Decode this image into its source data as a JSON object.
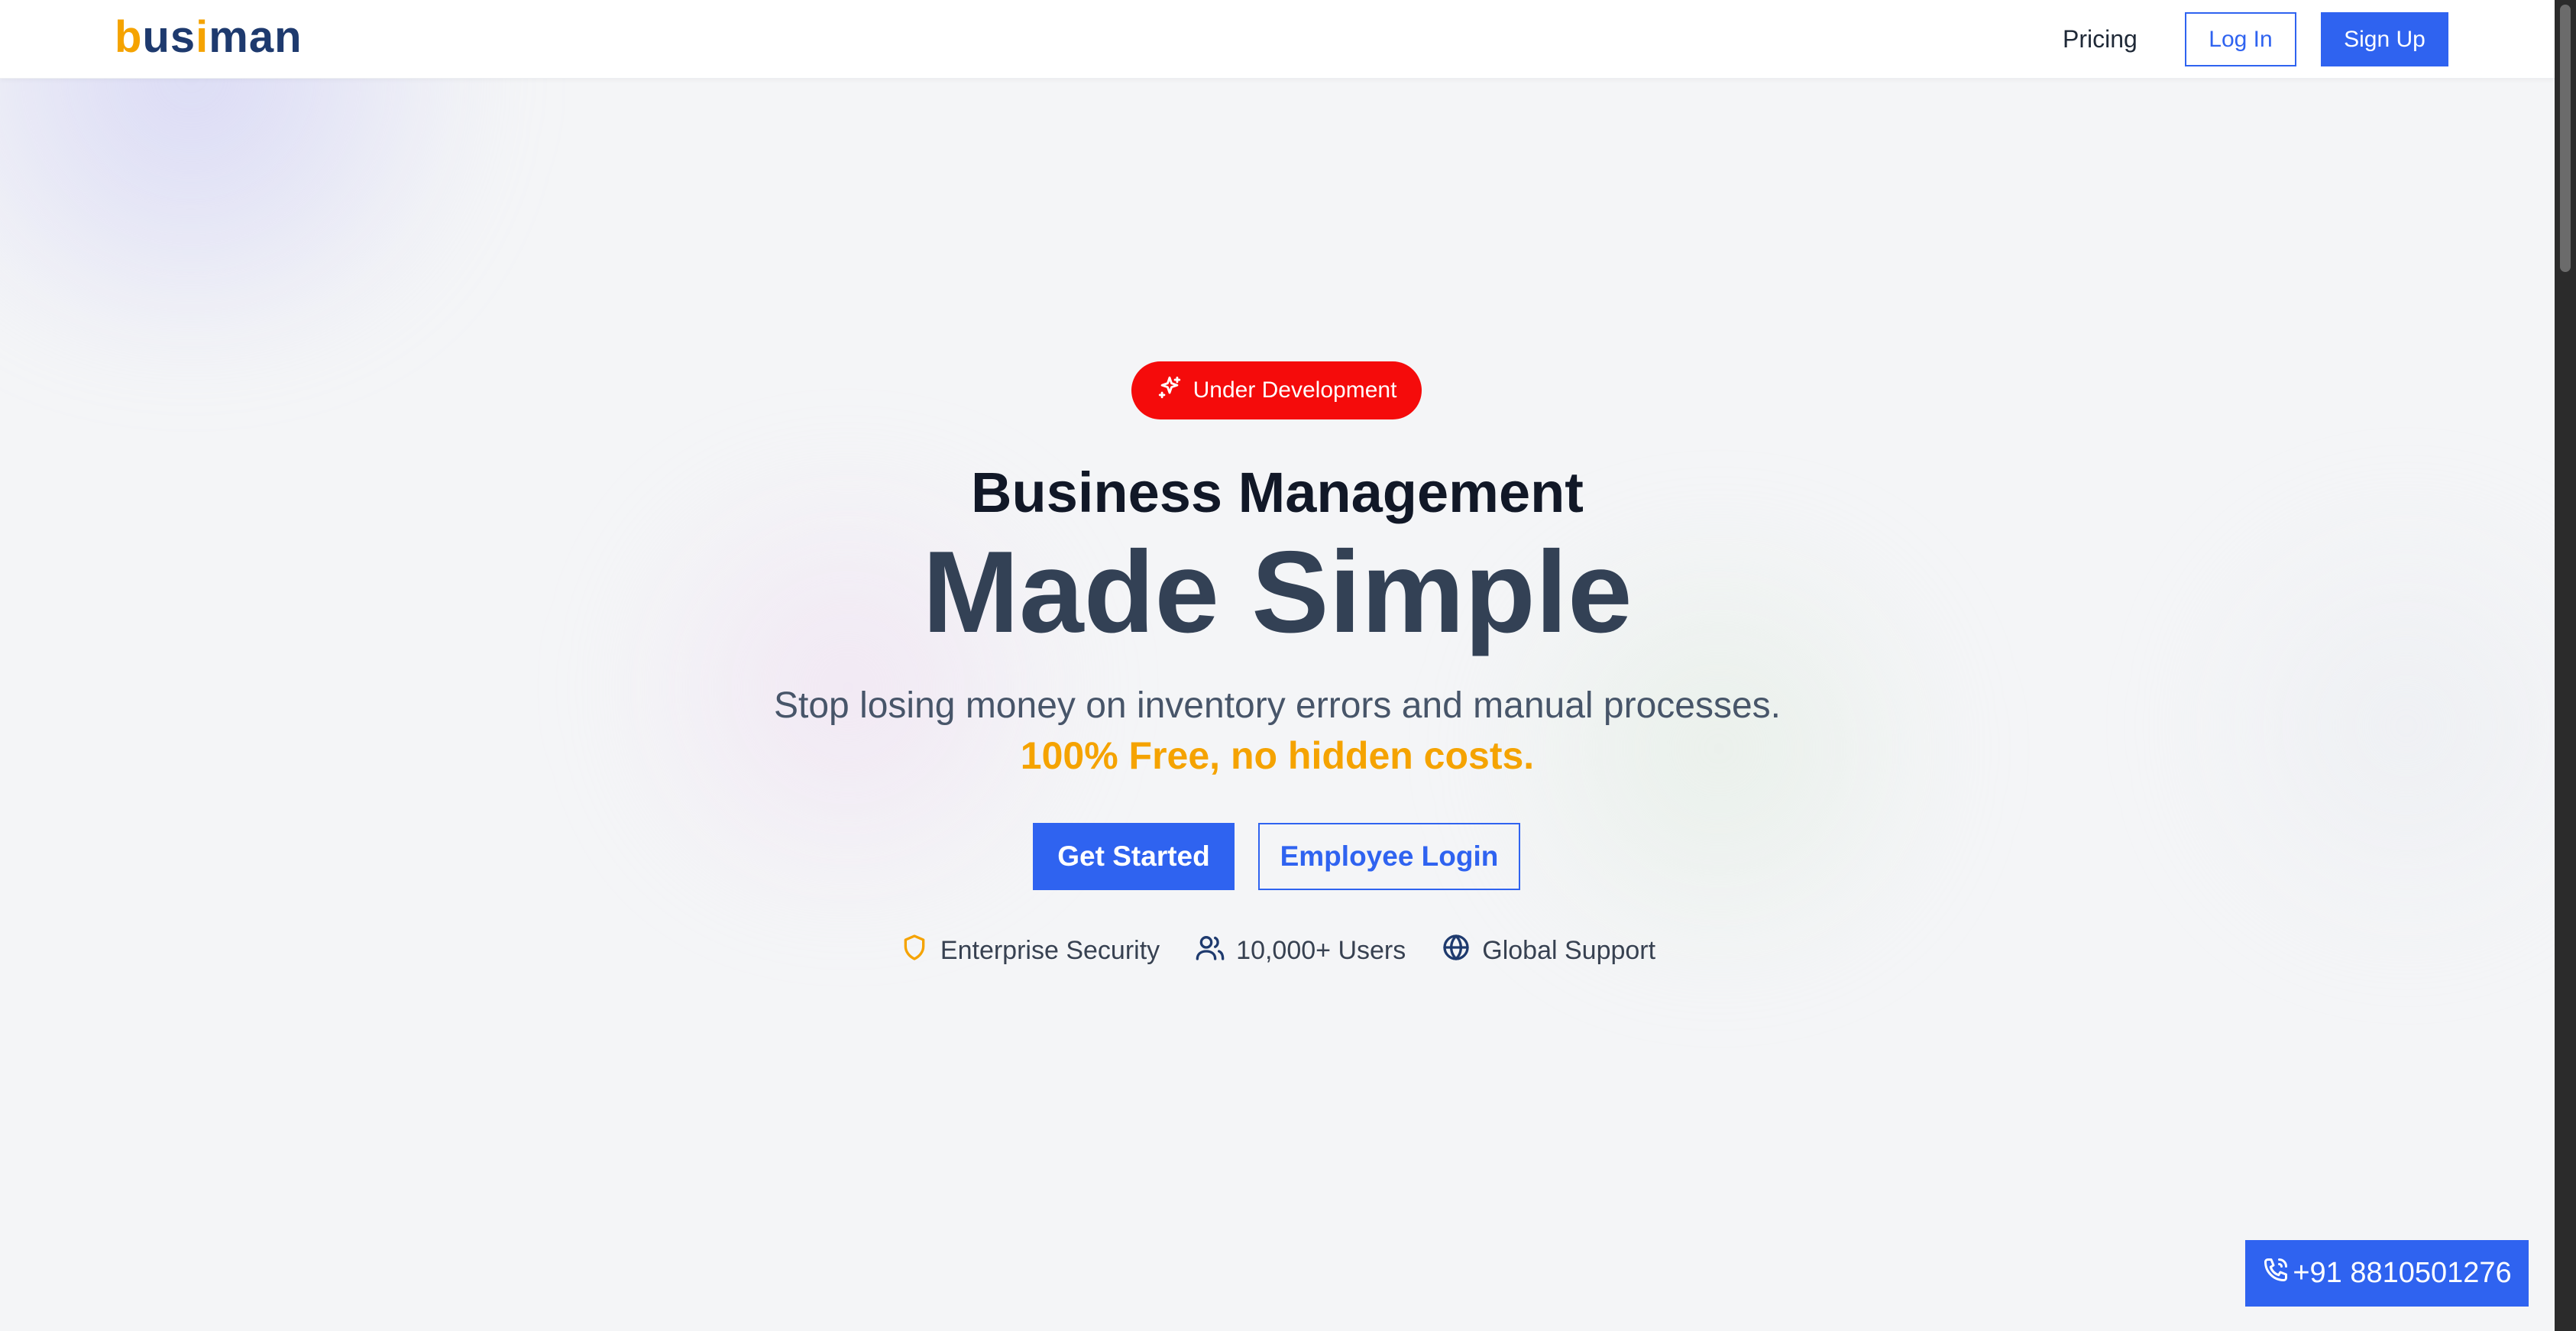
{
  "header": {
    "logo": {
      "b": "b",
      "us": "us",
      "i": "i",
      "man": "man"
    },
    "nav_pricing": "Pricing",
    "login_label": "Log In",
    "signup_label": "Sign Up"
  },
  "hero": {
    "badge_label": "Under Development",
    "badge_icon": "sparkles-icon",
    "title_line1": "Business Management",
    "title_line2": "Made Simple",
    "subtitle": "Stop losing money on inventory errors and manual processes.",
    "highlight": "100% Free, no hidden costs.",
    "primary_button": "Get Started",
    "secondary_button": "Employee Login",
    "features": [
      {
        "icon": "shield-icon",
        "label": "Enterprise Security"
      },
      {
        "icon": "users-icon",
        "label": "10,000+ Users"
      },
      {
        "icon": "globe-icon",
        "label": "Global Support"
      }
    ]
  },
  "contact": {
    "phone_label": "+91 8810501276",
    "icon": "phone-icon"
  },
  "colors": {
    "brand_blue": "#2f63f0",
    "accent_orange": "#f5a300",
    "badge_red": "#f50b0b"
  }
}
